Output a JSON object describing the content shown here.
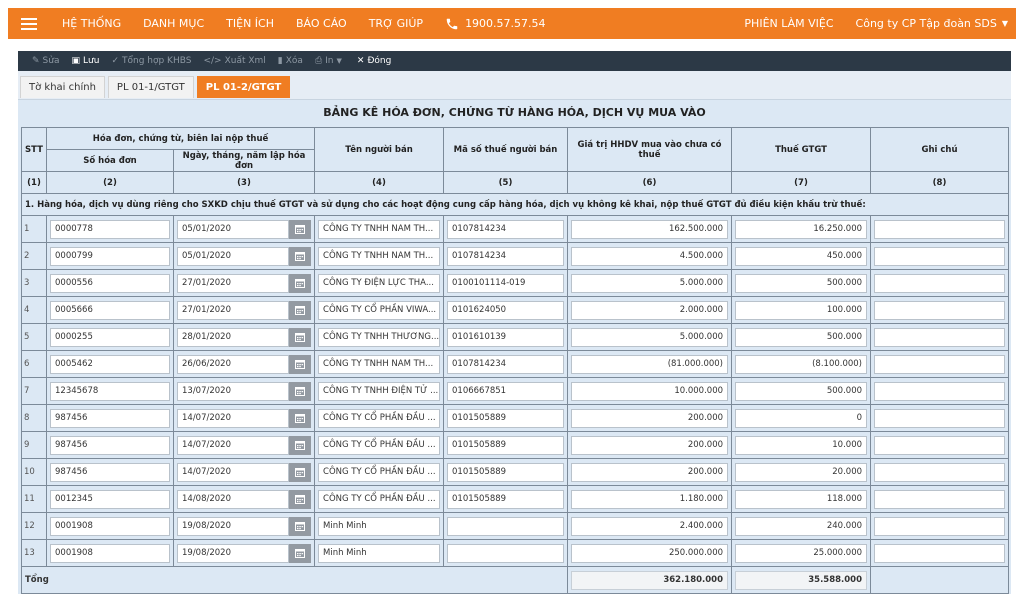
{
  "nav": {
    "items": [
      "HỆ THỐNG",
      "DANH MỤC",
      "TIỆN ÍCH",
      "BÁO CÁO",
      "TRỢ GIÚP"
    ],
    "phone": "1900.57.57.54",
    "session": "PHIÊN LÀM VIỆC",
    "company": "Công ty CP Tập đoàn SDS"
  },
  "toolbar": {
    "edit": "Sửa",
    "save": "Lưu",
    "summary": "Tổng hợp KHBS",
    "export_xml": "Xuất Xml",
    "delete": "Xóa",
    "print": "In",
    "close": "Đóng"
  },
  "tabs": [
    "Tờ khai chính",
    "PL 01-1/GTGT",
    "PL 01-2/GTGT"
  ],
  "active_tab": 2,
  "document": {
    "title": "BẢNG KÊ HÓA ĐƠN, CHỨNG TỪ HÀNG HÓA, DỊCH VỤ MUA VÀO",
    "headers": {
      "stt": "STT",
      "group": "Hóa đơn, chứng từ, biên lai nộp thuế",
      "invoice_no": "Số hóa đơn",
      "invoice_date": "Ngày, tháng, năm lập hóa đơn",
      "seller": "Tên người bán",
      "tax_code": "Mã số thuế người bán",
      "value": "Giá trị HHDV mua vào chưa có thuế",
      "vat": "Thuế GTGT",
      "note": "Ghi chú"
    },
    "col_numbers": [
      "(1)",
      "(2)",
      "(3)",
      "(4)",
      "(5)",
      "(6)",
      "(7)",
      "(8)"
    ],
    "section1": "1. Hàng hóa, dịch vụ dùng riêng cho SXKD chịu thuế GTGT và sử dụng cho các hoạt động cung cấp hàng hóa, dịch vụ không kê khai, nộp thuế GTGT đủ điều kiện khấu trừ thuế:",
    "rows": [
      {
        "stt": "1",
        "no": "0000778",
        "date": "05/01/2020",
        "seller": "CÔNG TY TNHH NAM TH...",
        "tax": "0107814234",
        "value": "162.500.000",
        "vat": "16.250.000",
        "note": ""
      },
      {
        "stt": "2",
        "no": "0000799",
        "date": "05/01/2020",
        "seller": "CÔNG TY TNHH NAM TH...",
        "tax": "0107814234",
        "value": "4.500.000",
        "vat": "450.000",
        "note": ""
      },
      {
        "stt": "3",
        "no": "0000556",
        "date": "27/01/2020",
        "seller": "CÔNG TY ĐIỆN LỰC THA...",
        "tax": "0100101114-019",
        "value": "5.000.000",
        "vat": "500.000",
        "note": ""
      },
      {
        "stt": "4",
        "no": "0005666",
        "date": "27/01/2020",
        "seller": "CÔNG TY CỔ PHẦN VIWA...",
        "tax": "0101624050",
        "value": "2.000.000",
        "vat": "100.000",
        "note": ""
      },
      {
        "stt": "5",
        "no": "0000255",
        "date": "28/01/2020",
        "seller": "CÔNG TY TNHH THƯƠNG...",
        "tax": "0101610139",
        "value": "5.000.000",
        "vat": "500.000",
        "note": ""
      },
      {
        "stt": "6",
        "no": "0005462",
        "date": "26/06/2020",
        "seller": "CÔNG TY TNHH NAM TH...",
        "tax": "0107814234",
        "value": "(81.000.000)",
        "vat": "(8.100.000)",
        "note": ""
      },
      {
        "stt": "7",
        "no": "12345678",
        "date": "13/07/2020",
        "seller": "CÔNG TY TNHH ĐIỆN TỬ ...",
        "tax": "0106667851",
        "value": "10.000.000",
        "vat": "500.000",
        "note": ""
      },
      {
        "stt": "8",
        "no": "987456",
        "date": "14/07/2020",
        "seller": "CÔNG TY CỔ PHẦN ĐẦU ...",
        "tax": "0101505889",
        "value": "200.000",
        "vat": "0",
        "note": ""
      },
      {
        "stt": "9",
        "no": "987456",
        "date": "14/07/2020",
        "seller": "CÔNG TY CỔ PHẦN ĐẦU ...",
        "tax": "0101505889",
        "value": "200.000",
        "vat": "10.000",
        "note": ""
      },
      {
        "stt": "10",
        "no": "987456",
        "date": "14/07/2020",
        "seller": "CÔNG TY CỔ PHẦN ĐẦU ...",
        "tax": "0101505889",
        "value": "200.000",
        "vat": "20.000",
        "note": ""
      },
      {
        "stt": "11",
        "no": "0012345",
        "date": "14/08/2020",
        "seller": "CÔNG TY CỔ PHẦN ĐẦU ...",
        "tax": "0101505889",
        "value": "1.180.000",
        "vat": "118.000",
        "note": ""
      },
      {
        "stt": "12",
        "no": "0001908",
        "date": "19/08/2020",
        "seller": "Minh Minh",
        "tax": "",
        "value": "2.400.000",
        "vat": "240.000",
        "note": ""
      },
      {
        "stt": "13",
        "no": "0001908",
        "date": "19/08/2020",
        "seller": "Minh Minh",
        "tax": "",
        "value": "250.000.000",
        "vat": "25.000.000",
        "note": ""
      }
    ],
    "total": {
      "label": "Tổng",
      "value": "362.180.000",
      "vat": "35.588.000"
    }
  },
  "colors": {
    "accent": "#f07d22",
    "toolbar": "#2c3946",
    "doc_bg": "#dce8f4"
  }
}
